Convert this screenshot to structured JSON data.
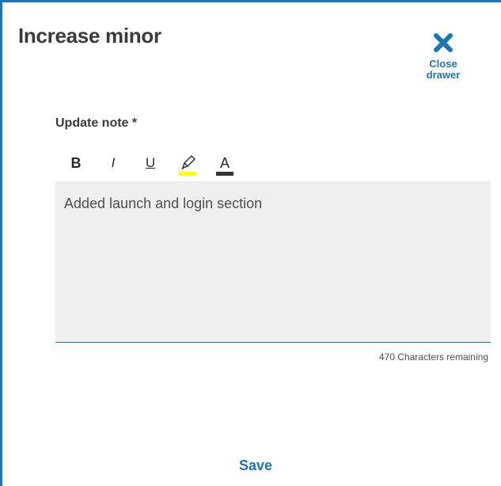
{
  "drawer": {
    "title": "Increase minor",
    "close_label_line1": "Close",
    "close_label_line2": "drawer",
    "field_label": "Update note *",
    "toolbar": {
      "bold": "B",
      "italic": "I",
      "underline": "U",
      "highlight_icon": "highlighter-icon",
      "font_color_icon": "font-color-icon",
      "font_color_letter": "A",
      "highlight_color": "#ffff00",
      "font_color": "#333333"
    },
    "note_value": "Added launch and login section",
    "chars_remaining": "470 Characters remaining",
    "save_label": "Save"
  },
  "colors": {
    "accent": "#1b75bb",
    "field_bg": "#efefef",
    "title_text": "#3a3a3a"
  }
}
